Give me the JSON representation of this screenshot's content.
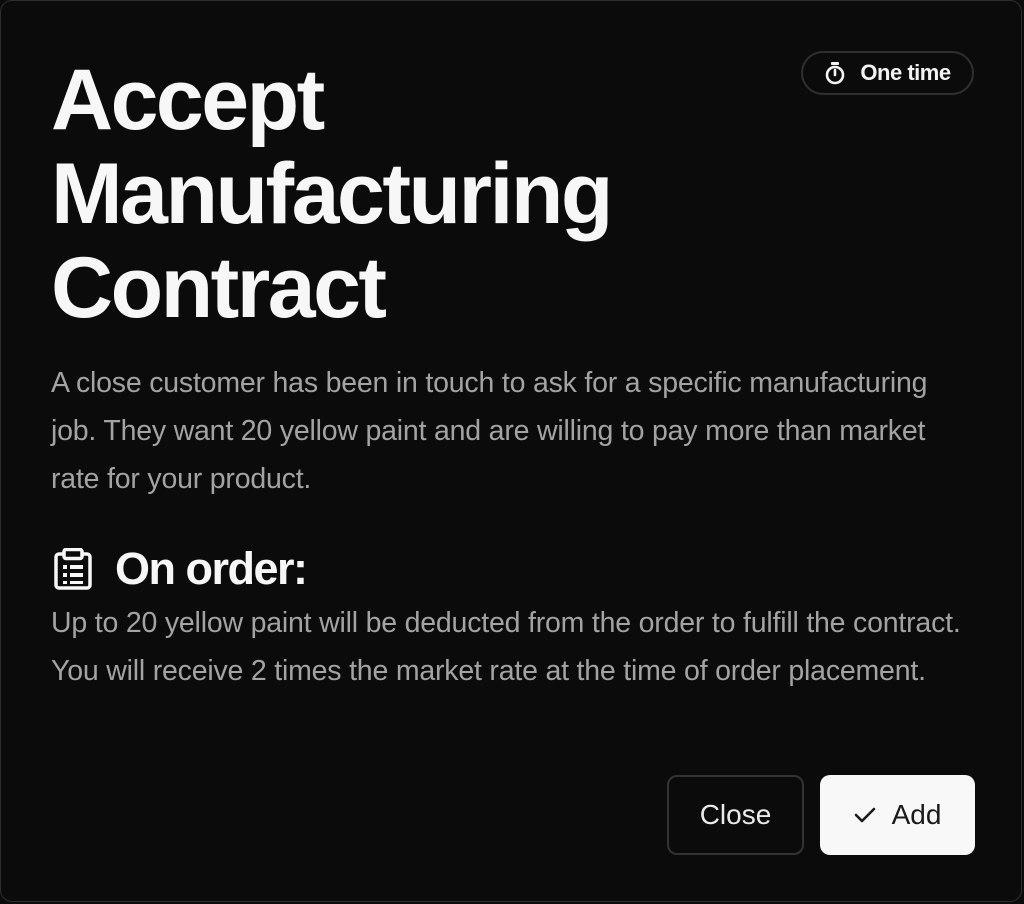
{
  "badge": {
    "icon": "stopwatch-icon",
    "label": "One time"
  },
  "dialog": {
    "title": "Accept Manufacturing Contract",
    "description": "A close customer has been in touch to ask for a specific manufacturing job. They want 20 yellow paint and are willing to pay more than market rate for your product."
  },
  "on_order": {
    "icon": "clipboard-icon",
    "heading": "On order:",
    "text": "Up to 20 yellow paint will be deducted from the order to fulfill the contract. You will receive 2 times the market rate at the time of order placement."
  },
  "actions": {
    "close_label": "Close",
    "add_label": "Add",
    "add_icon": "check-icon"
  },
  "colors": {
    "background": "#0b0b0b",
    "border": "#2e2e2e",
    "title_text": "#f7f7f7",
    "body_text": "#a3a3a3",
    "primary_button_bg": "#f8f8f8"
  }
}
